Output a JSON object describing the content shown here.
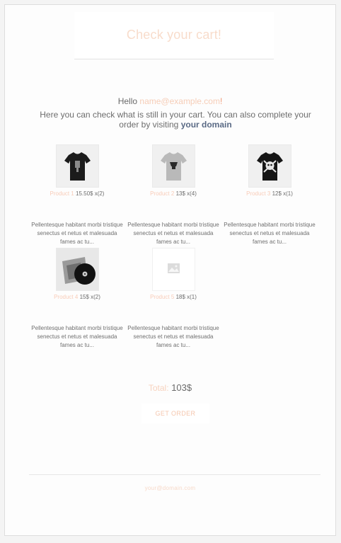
{
  "header": {
    "title": "Check your cart!"
  },
  "greeting": {
    "hello": "Hello",
    "email": "name@example.com",
    "exclaim": "!"
  },
  "intro": {
    "text": "Here you can check what is still in your cart. You can also complete your order by visiting",
    "link": "your domain"
  },
  "products": [
    {
      "name": "Product 1",
      "price": "15.50$ x(2)",
      "description": "Pellentesque habitant morbi tristique senectus et netus et malesuada fames ac tu...",
      "image_icon": "black-tshirt-icon"
    },
    {
      "name": "Product 2",
      "price": "13$ x(4)",
      "description": "Pellentesque habitant morbi tristique senectus et netus et malesuada fames ac tu...",
      "image_icon": "grey-tshirt-icon"
    },
    {
      "name": "Product 3",
      "price": "12$ x(1)",
      "description": "Pellentesque habitant morbi tristique senectus et netus et malesuada fames ac tu...",
      "image_icon": "black-skull-tshirt-icon"
    },
    {
      "name": "Product 4",
      "price": "15$ x(2)",
      "description": "Pellentesque habitant morbi tristique senectus et netus et malesuada fames ac tu...",
      "image_icon": "vinyl-record-icon"
    },
    {
      "name": "Product 5",
      "price": "18$ x(1)",
      "description": "Pellentesque habitant morbi tristique senectus et netus et malesuada fames ac tu...",
      "image_icon": "image-placeholder-icon"
    }
  ],
  "total": {
    "label": "Total:",
    "value": "103$"
  },
  "cta": {
    "label": "GET ORDER"
  },
  "footer": {
    "text": "your@domain.com"
  },
  "colors": {
    "accent": "#f6c9b2",
    "link": "#5a6a85",
    "text": "#6d6d6d"
  }
}
